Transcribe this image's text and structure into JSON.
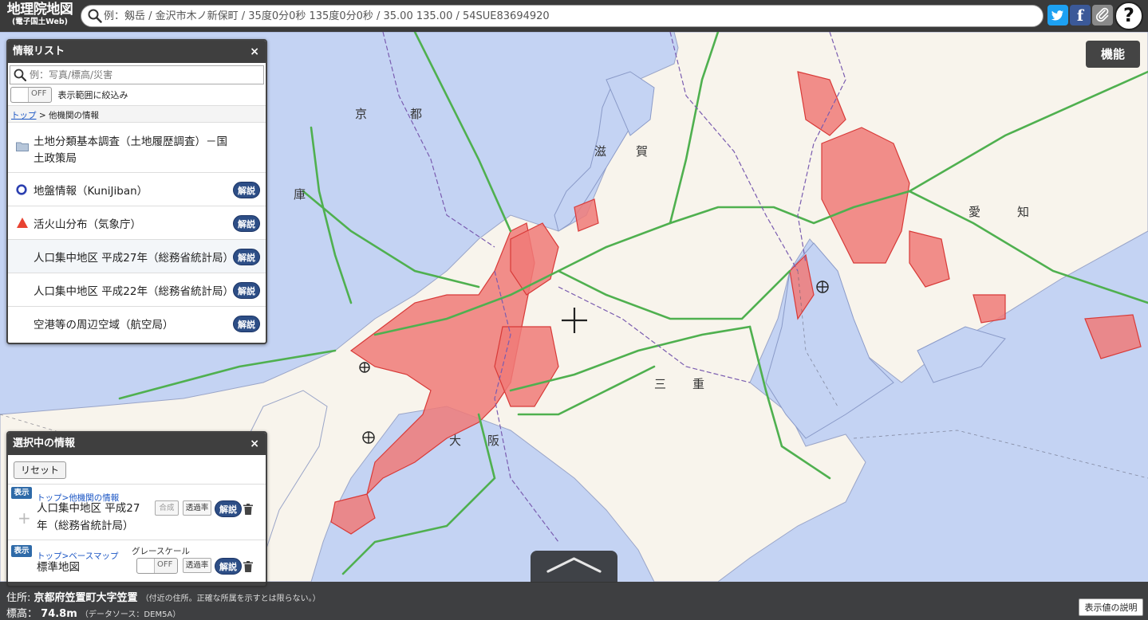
{
  "app": {
    "logo_title": "地理院地図",
    "logo_subtitle": "(電子国土Web)"
  },
  "search": {
    "placeholder": "例：剱岳 / 金沢市木ノ新保町 / 35度0分0秒 135度0分0秒 / 35.00 135.00 / 54SUE83694920"
  },
  "header_buttons": {
    "twitter_icon": "twitter-icon",
    "facebook_label": "f",
    "clip_icon": "paperclip-icon",
    "help_label": "?"
  },
  "map": {
    "function_button": "機能",
    "labels": [
      "京",
      "都",
      "滋",
      "賀",
      "庫",
      "愛",
      "知",
      "三",
      "重",
      "大",
      "阪"
    ],
    "colors": {
      "water": "#c4d3f3",
      "land": "#f8f4ec",
      "urban": "#f07a78",
      "urban_stroke": "#d83a38",
      "road": "#4fb04f"
    }
  },
  "info_list": {
    "title": "情報リスト",
    "close": "×",
    "search_placeholder": "例：写真/標高/災害",
    "filter_toggle": "OFF",
    "filter_label": "表示範囲に絞込み",
    "breadcrumb_top": "トップ",
    "breadcrumb_sep": " > ",
    "breadcrumb_current": "他機関の情報",
    "items": [
      {
        "line1": "土地分類基本調査（土地履歴調査）－国",
        "line2": "土政策局",
        "icon": "folder-icon"
      },
      {
        "label": "地盤情報（KuniJiban）",
        "icon": "circle-icon",
        "button": "解説"
      },
      {
        "label": "活火山分布（気象庁）",
        "icon": "triangle-icon",
        "button": "解説"
      },
      {
        "label": "人口集中地区 平成27年（総務省統計局）",
        "button": "解説"
      },
      {
        "label": "人口集中地区 平成22年（総務省統計局）",
        "button": "解説"
      },
      {
        "label": "空港等の周辺空域（航空局）",
        "button": "解説"
      }
    ]
  },
  "selected": {
    "title": "選択中の情報",
    "close": "×",
    "reset": "リセット",
    "rows": [
      {
        "badge": "表示",
        "path": "トップ>他機関の情報",
        "title_line1": "人口集中地区 平成27",
        "title_line2": "年（総務省統計局）",
        "composite": "合成",
        "transparency": "透過率",
        "explain": "解説"
      },
      {
        "badge": "表示",
        "path": "トップ>ベースマップ",
        "grayscale_label": "グレースケール",
        "grayscale_toggle": "OFF",
        "title_line1": "標準地図",
        "transparency": "透過率",
        "explain": "解説"
      }
    ]
  },
  "status": {
    "address_label": "住所:",
    "address_value": "京都府笠置町大字笠置",
    "address_note": "（付近の住所。正確な所属を示すとは限らない。）",
    "elevation_label": "標高：",
    "elevation_value": "74.8m",
    "elevation_source": "（データソース：DEM5A）",
    "explain_button": "表示値の説明"
  }
}
